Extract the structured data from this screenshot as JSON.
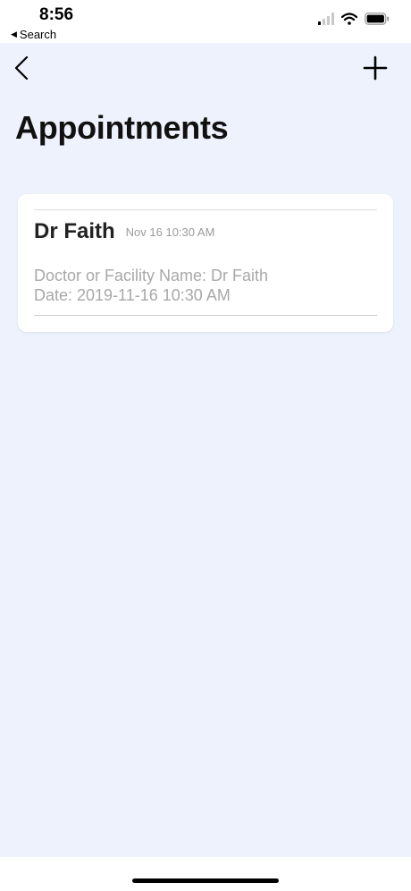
{
  "status_bar": {
    "time": "8:56",
    "back_label": "Search",
    "icons": [
      "signal-icon",
      "wifi-icon",
      "battery-icon"
    ]
  },
  "nav": {
    "back_icon": "chevron-left-icon",
    "add_icon": "plus-icon"
  },
  "page": {
    "title": "Appointments"
  },
  "appointments": [
    {
      "name": "Dr Faith",
      "short_datetime": "Nov 16 10:30 AM",
      "facility_line": "Doctor or Facility Name: Dr Faith",
      "date_line": "Date: 2019-11-16 10:30 AM"
    }
  ],
  "colors": {
    "background": "#eef2fc",
    "card": "#ffffff",
    "muted_text": "#a8a8a8"
  }
}
